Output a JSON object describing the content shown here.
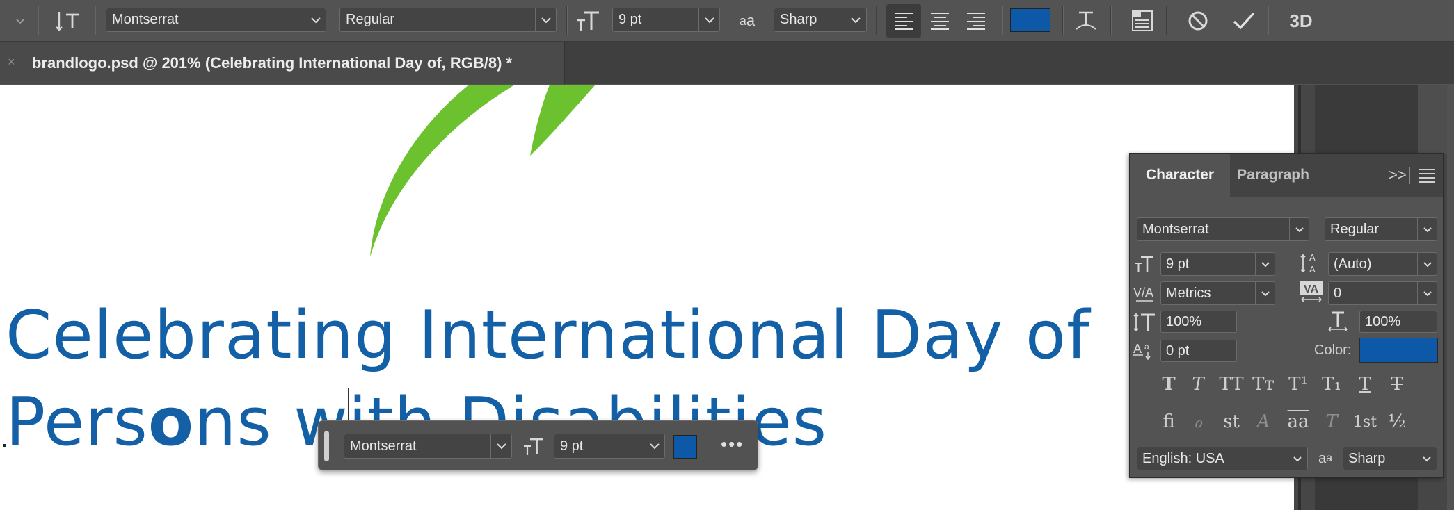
{
  "optbar": {
    "font_family": "Montserrat",
    "font_style": "Regular",
    "font_size": "9 pt",
    "antialias_label": "a",
    "antialias_value": "Sharp",
    "text_color": "#0e58a8",
    "icons": [
      "tool-preset-icon",
      "text-orientation-icon",
      "font-size-icon",
      "antialias-icon",
      "align-left-icon",
      "align-center-icon",
      "align-right-icon",
      "warp-text-icon",
      "character-panel-icon",
      "cancel-icon",
      "commit-icon",
      "3d-icon"
    ],
    "threed_label": "3D"
  },
  "tab": {
    "close": "×",
    "title": "brandlogo.psd @ 201% (Celebrating International Day of, RGB/8) *"
  },
  "canvas": {
    "line1": "Celebrating International Day of",
    "line2_a": "Pers",
    "line2_b": "o",
    "line2_c": "ns with Disabilities",
    "brand_green": "#6cc12e",
    "text_color": "#1460a6"
  },
  "ctxbar": {
    "font_family": "Montserrat",
    "font_size": "9 pt",
    "more": "•••",
    "color": "#0e58a8"
  },
  "character_panel": {
    "tab_character": "Character",
    "tab_paragraph": "Paragraph",
    "collapse": ">>",
    "font_family": "Montserrat",
    "font_style": "Regular",
    "font_size": "9 pt",
    "leading": "(Auto)",
    "kerning": "Metrics",
    "tracking": "0",
    "vertical_scale": "100%",
    "horizontal_scale": "100%",
    "baseline_shift": "0 pt",
    "color_label": "Color:",
    "color": "#0e58a8",
    "language": "English: USA",
    "antialias": "Sharp",
    "typestyle_buttons": [
      "T",
      "T",
      "TT",
      "Tт",
      "T¹",
      "T₁",
      "T",
      "T"
    ],
    "opentype_buttons": [
      "fi",
      "ℴ",
      "st",
      "A",
      "aa",
      "T",
      "1st",
      "½"
    ]
  }
}
